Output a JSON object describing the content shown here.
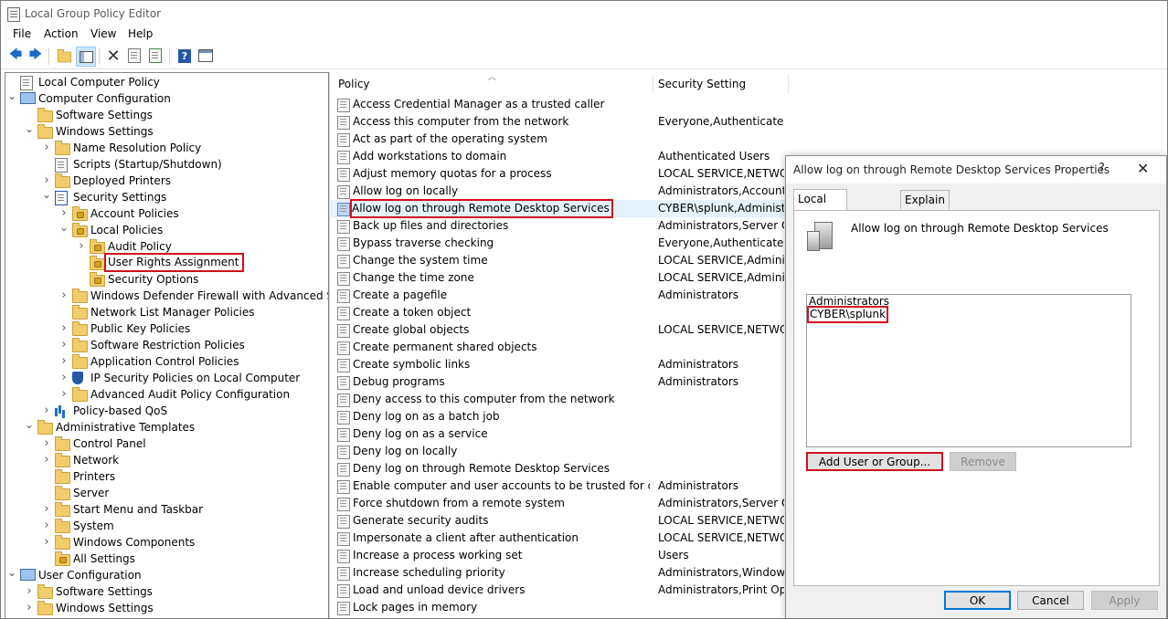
{
  "window": {
    "title": "Local Group Policy Editor"
  },
  "menu": [
    "File",
    "Action",
    "View",
    "Help"
  ],
  "toolbar": {
    "icons": [
      "back-arrow-icon",
      "forward-arrow-icon",
      "up-folder-icon",
      "show-hide-tree-icon",
      "delete-icon",
      "properties-icon",
      "export-list-icon",
      "help-icon",
      "view-icon"
    ]
  },
  "tree": [
    {
      "label": "Local Computer Policy",
      "icon": "doc",
      "level": 0,
      "exp": ""
    },
    {
      "label": "Computer Configuration",
      "icon": "pc",
      "level": 0,
      "exp": "v"
    },
    {
      "label": "Software Settings",
      "icon": "folder",
      "level": 1,
      "exp": ""
    },
    {
      "label": "Windows Settings",
      "icon": "folder",
      "level": 1,
      "exp": "v"
    },
    {
      "label": "Name Resolution Policy",
      "icon": "folder",
      "level": 2,
      "exp": ">"
    },
    {
      "label": "Scripts (Startup/Shutdown)",
      "icon": "doc",
      "level": 2,
      "exp": ""
    },
    {
      "label": "Deployed Printers",
      "icon": "folder",
      "level": 2,
      "exp": ">"
    },
    {
      "label": "Security Settings",
      "icon": "docsec",
      "level": 2,
      "exp": "v"
    },
    {
      "label": "Account Policies",
      "icon": "lockfolder",
      "level": 3,
      "exp": ">"
    },
    {
      "label": "Local Policies",
      "icon": "lockfolder",
      "level": 3,
      "exp": "v"
    },
    {
      "label": "Audit Policy",
      "icon": "lockfolder",
      "level": 4,
      "exp": ">"
    },
    {
      "label": "User Rights Assignment",
      "icon": "lockfolder",
      "level": 4,
      "exp": "",
      "highlight": true
    },
    {
      "label": "Security Options",
      "icon": "lockfolder",
      "level": 4,
      "exp": ""
    },
    {
      "label": "Windows Defender Firewall with Advanced Secu",
      "icon": "folder",
      "level": 3,
      "exp": ">"
    },
    {
      "label": "Network List Manager Policies",
      "icon": "folder",
      "level": 3,
      "exp": ""
    },
    {
      "label": "Public Key Policies",
      "icon": "folder",
      "level": 3,
      "exp": ">"
    },
    {
      "label": "Software Restriction Policies",
      "icon": "folder",
      "level": 3,
      "exp": ">"
    },
    {
      "label": "Application Control Policies",
      "icon": "folder",
      "level": 3,
      "exp": ">"
    },
    {
      "label": "IP Security Policies on Local Computer",
      "icon": "shield",
      "level": 3,
      "exp": ">"
    },
    {
      "label": "Advanced Audit Policy Configuration",
      "icon": "folder",
      "level": 3,
      "exp": ">"
    },
    {
      "label": "Policy-based QoS",
      "icon": "bar",
      "level": 2,
      "exp": ">"
    },
    {
      "label": "Administrative Templates",
      "icon": "folder",
      "level": 1,
      "exp": "v"
    },
    {
      "label": "Control Panel",
      "icon": "folder",
      "level": 2,
      "exp": ">"
    },
    {
      "label": "Network",
      "icon": "folder",
      "level": 2,
      "exp": ">"
    },
    {
      "label": "Printers",
      "icon": "folder",
      "level": 2,
      "exp": ""
    },
    {
      "label": "Server",
      "icon": "folder",
      "level": 2,
      "exp": ""
    },
    {
      "label": "Start Menu and Taskbar",
      "icon": "folder",
      "level": 2,
      "exp": ">"
    },
    {
      "label": "System",
      "icon": "folder",
      "level": 2,
      "exp": ">"
    },
    {
      "label": "Windows Components",
      "icon": "folder",
      "level": 2,
      "exp": ">"
    },
    {
      "label": "All Settings",
      "icon": "lockfolder",
      "level": 2,
      "exp": ""
    },
    {
      "label": "User Configuration",
      "icon": "pc",
      "level": 0,
      "exp": "v"
    },
    {
      "label": "Software Settings",
      "icon": "folder",
      "level": 1,
      "exp": ">"
    },
    {
      "label": "Windows Settings",
      "icon": "folder",
      "level": 1,
      "exp": ">"
    }
  ],
  "list": {
    "columns": [
      "Policy",
      "Security Setting"
    ],
    "rows": [
      {
        "policy": "Access Credential Manager as a trusted caller",
        "setting": ""
      },
      {
        "policy": "Access this computer from the network",
        "setting": "Everyone,Authenticated ..."
      },
      {
        "policy": "Act as part of the operating system",
        "setting": ""
      },
      {
        "policy": "Add workstations to domain",
        "setting": "Authenticated Users"
      },
      {
        "policy": "Adjust memory quotas for a process",
        "setting": "LOCAL SERVICE,NETWO..."
      },
      {
        "policy": "Allow log on locally",
        "setting": "Administrators,Account ..."
      },
      {
        "policy": "Allow log on through Remote Desktop Services",
        "setting": "CYBER\\splunk,Administ...",
        "highlight": true
      },
      {
        "policy": "Back up files and directories",
        "setting": "Administrators,Server O..."
      },
      {
        "policy": "Bypass traverse checking",
        "setting": "Everyone,Authenticated ..."
      },
      {
        "policy": "Change the system time",
        "setting": "LOCAL SERVICE,Admini..."
      },
      {
        "policy": "Change the time zone",
        "setting": "LOCAL SERVICE,Admini..."
      },
      {
        "policy": "Create a pagefile",
        "setting": "Administrators"
      },
      {
        "policy": "Create a token object",
        "setting": ""
      },
      {
        "policy": "Create global objects",
        "setting": "LOCAL SERVICE,NETWO..."
      },
      {
        "policy": "Create permanent shared objects",
        "setting": ""
      },
      {
        "policy": "Create symbolic links",
        "setting": "Administrators"
      },
      {
        "policy": "Debug programs",
        "setting": "Administrators"
      },
      {
        "policy": "Deny access to this computer from the network",
        "setting": ""
      },
      {
        "policy": "Deny log on as a batch job",
        "setting": ""
      },
      {
        "policy": "Deny log on as a service",
        "setting": ""
      },
      {
        "policy": "Deny log on locally",
        "setting": ""
      },
      {
        "policy": "Deny log on through Remote Desktop Services",
        "setting": ""
      },
      {
        "policy": "Enable computer and user accounts to be trusted for delega...",
        "setting": "Administrators"
      },
      {
        "policy": "Force shutdown from a remote system",
        "setting": "Administrators,Server O..."
      },
      {
        "policy": "Generate security audits",
        "setting": "LOCAL SERVICE,NETWO..."
      },
      {
        "policy": "Impersonate a client after authentication",
        "setting": "LOCAL SERVICE,NETWO..."
      },
      {
        "policy": "Increase a process working set",
        "setting": "Users"
      },
      {
        "policy": "Increase scheduling priority",
        "setting": "Administrators,Window ..."
      },
      {
        "policy": "Load and unload device drivers",
        "setting": "Administrators,Print Op..."
      },
      {
        "policy": "Lock pages in memory",
        "setting": ""
      }
    ]
  },
  "dialog": {
    "title": "Allow log on through Remote Desktop Services Properties",
    "help": "?",
    "close": "✕",
    "tabs": [
      "Local Security Setting",
      "Explain"
    ],
    "policy_label": "Allow log on through Remote Desktop Services",
    "members": [
      "Administrators",
      "CYBER\\splunk"
    ],
    "add_button": "Add User or Group...",
    "remove_button": "Remove",
    "ok_button": "OK",
    "cancel_button": "Cancel",
    "apply_button": "Apply"
  },
  "colors": {
    "highlight_red": "#d00f1f",
    "selection_blue": "#e5f1fb",
    "accent": "#0078d7"
  }
}
